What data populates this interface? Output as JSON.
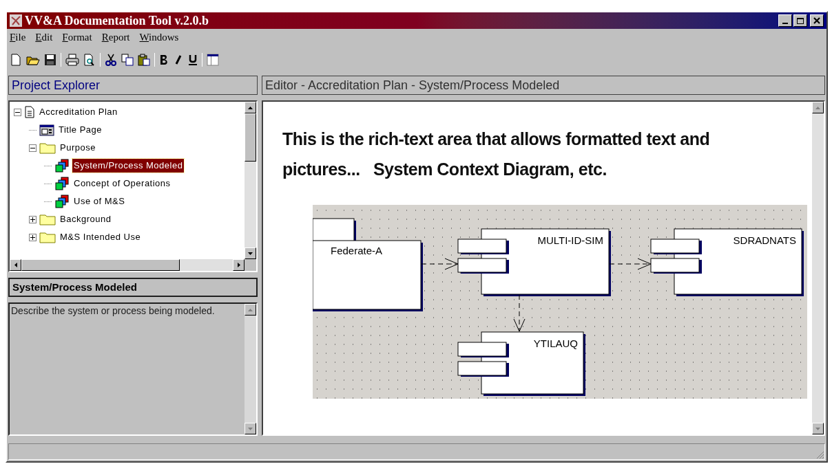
{
  "window": {
    "title": "VV&A Documentation Tool v.2.0.b"
  },
  "menu": [
    {
      "mnemonic": "F",
      "rest": "ile"
    },
    {
      "mnemonic": "E",
      "rest": "dit"
    },
    {
      "mnemonic": "F",
      "rest": "ormat"
    },
    {
      "mnemonic": "R",
      "rest": "eport"
    },
    {
      "mnemonic": "W",
      "rest": "indows"
    }
  ],
  "project_explorer": {
    "title": "Project Explorer",
    "tree": [
      {
        "label": "Accreditation Plan",
        "kind": "document",
        "expanded": true,
        "selected": false,
        "children": [
          {
            "label": "Title Page",
            "kind": "page",
            "selected": false
          },
          {
            "label": "Purpose",
            "kind": "folder",
            "expanded": true,
            "selected": false,
            "children": [
              {
                "label": "System/Process Modeled",
                "kind": "component",
                "selected": true
              },
              {
                "label": "Concept of Operations",
                "kind": "component",
                "selected": false
              },
              {
                "label": "Use of M&S",
                "kind": "component",
                "selected": false
              }
            ]
          },
          {
            "label": "Background",
            "kind": "folder",
            "expanded": false,
            "selected": false
          },
          {
            "label": "M&S Intended Use",
            "kind": "folder",
            "expanded": false,
            "selected": false
          }
        ]
      }
    ]
  },
  "detail": {
    "title": "System/Process Modeled",
    "description": "Describe the system or process being modeled."
  },
  "editor": {
    "title": "Editor - Accreditation Plan - System/Process Modeled",
    "text": "This is the rich-text area that allows formatted text and pictures...   System Context Diagram, etc.",
    "diagram": {
      "components": [
        "Federate-A",
        "MULTI-ID-SIM",
        "SDRADNATS",
        "YTILAUQ"
      ]
    }
  }
}
